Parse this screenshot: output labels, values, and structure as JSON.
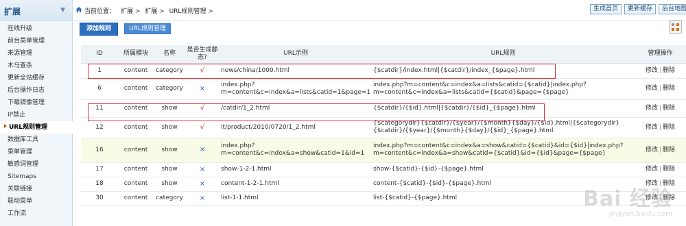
{
  "sidebar": {
    "title": "扩展",
    "toggle": "▼",
    "items": [
      {
        "label": "在线升级"
      },
      {
        "label": "前台菜单管理"
      },
      {
        "label": "来源管理"
      },
      {
        "label": "木马查杀"
      },
      {
        "label": "更新全站缓存"
      },
      {
        "label": "后台操作日志"
      },
      {
        "label": "下载镜像管理"
      },
      {
        "label": "IP禁止"
      },
      {
        "label": "URL规则管理",
        "active": true
      },
      {
        "label": "数据库工具"
      },
      {
        "label": "菜单管理"
      },
      {
        "label": "敏感词管理"
      },
      {
        "label": "Sitemaps"
      },
      {
        "label": "关联链接"
      },
      {
        "label": "联动菜单"
      },
      {
        "label": "工作流"
      }
    ]
  },
  "header": {
    "crumb_prefix": "当前位置：",
    "crumbs": [
      "扩展 >",
      "扩展 >",
      "URL规则管理 >"
    ],
    "actions": [
      "生成首页",
      "更新缓存",
      "后台地图"
    ]
  },
  "toolbar": {
    "add_label": "添加规则",
    "manage_label": "URL规则管理"
  },
  "table": {
    "headers": [
      "ID",
      "所属模块",
      "名称",
      "是否生成静态?",
      "URL示例",
      "URL规则",
      "管理操作"
    ],
    "edit_label": "修改",
    "sep_label": "|",
    "delete_label": "删除",
    "rows": [
      {
        "id": "1",
        "module": "content",
        "name": "category",
        "static": "√",
        "example": "news/china/1000.html",
        "rule": "{$catdir}/index.html|{$catdir}/index_{$page}.html"
      },
      {
        "id": "6",
        "module": "content",
        "name": "category",
        "static": "×",
        "example": "index.php?m=content&c=index&a=lists&catid=1&page=1",
        "rule": "index.php?m=content&c=index&a=lists&catid={$catid}|index.php?m=content&c=index&a=lists&catid={$catid}&page={$page}"
      },
      {
        "id": "11",
        "module": "content",
        "name": "show",
        "static": "√",
        "example": "/catdir/1_2.html",
        "rule": "{$catdir}/{$id}.html|{$catdir}/{$id}_{$page}.html"
      },
      {
        "id": "12",
        "module": "content",
        "name": "show",
        "static": "√",
        "example": "it/product/2010/0720/1_2.html",
        "rule": "{$categorydir}{$catdir}/{$year}/{$month}{$day}/{$id}.html|{$categorydir}{$catdir}/{$year}/{$month}{$day}/{$id}_{$page}.html"
      },
      {
        "id": "16",
        "module": "content",
        "name": "show",
        "static": "×",
        "example": "index.php?m=content&c=index&a=show&catid=1&id=1",
        "rule": "index.php?m=content&c=index&a=show&catid={$catid}&id={$id}|index.php?m=content&c=index&a=show&catid={$catid}&id={$id}&page={$page}",
        "highlight": true
      },
      {
        "id": "17",
        "module": "content",
        "name": "show",
        "static": "×",
        "example": "show-1-2-1.html",
        "rule": "show-{$catid}-{$id}-{$page}.html"
      },
      {
        "id": "18",
        "module": "content",
        "name": "show",
        "static": "×",
        "example": "content-1-2-1.html",
        "rule": "content-{$catid}-{$id}-{$page}.html"
      },
      {
        "id": "30",
        "module": "content",
        "name": "category",
        "static": "×",
        "example": "list-1-1.html",
        "rule": "list-{$catid}-{$page}.html"
      }
    ]
  },
  "watermark": {
    "main": "Bai 经验",
    "sub": "jingyan.baidu.com"
  },
  "colors": {
    "accent": "#2b6fbf",
    "yes": "#e03a2e",
    "no": "#2a5fb5",
    "highlight_box": "#d9333b"
  }
}
